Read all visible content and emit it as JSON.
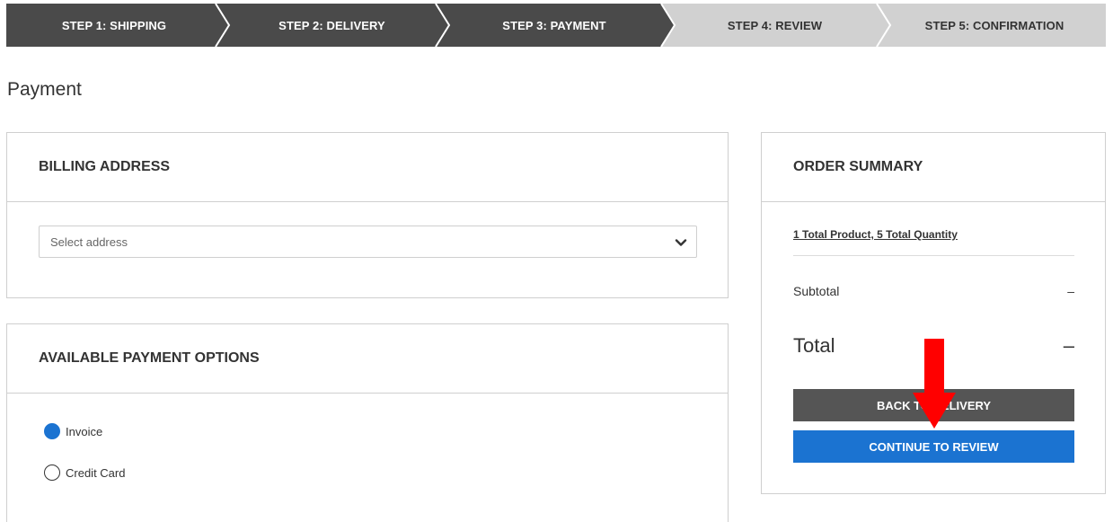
{
  "stepper": {
    "steps": [
      {
        "label": "STEP 1: SHIPPING",
        "state": "done"
      },
      {
        "label": "STEP 2: DELIVERY",
        "state": "done"
      },
      {
        "label": "STEP 3: PAYMENT",
        "state": "active"
      },
      {
        "label": "STEP 4: REVIEW",
        "state": "todo"
      },
      {
        "label": "STEP 5: CONFIRMATION",
        "state": "todo"
      }
    ],
    "colors": {
      "done": "#4a4a4a",
      "todo": "#d1d1d1",
      "separator": "#ffffff"
    }
  },
  "page": {
    "title": "Payment"
  },
  "billing": {
    "header": "BILLING ADDRESS",
    "select_value": "Select address",
    "chevron_icon": "chevron-down-icon"
  },
  "payment_options": {
    "header": "AVAILABLE PAYMENT OPTIONS",
    "options": [
      {
        "label": "Invoice",
        "checked": true
      },
      {
        "label": "Credit Card",
        "checked": false
      }
    ],
    "accent": "#1b73d1"
  },
  "summary": {
    "header": "ORDER SUMMARY",
    "link": "1 Total Product, 5 Total Quantity",
    "subtotal_label": "Subtotal",
    "subtotal_value": "–",
    "total_label": "Total",
    "total_value": "–",
    "back_button": "BACK TO DELIVERY",
    "continue_button": "CONTINUE TO REVIEW",
    "back_color": "#555555",
    "continue_color": "#1b73d1"
  },
  "annotation": {
    "icon": "red-arrow-down-icon",
    "color": "#ff0000"
  }
}
